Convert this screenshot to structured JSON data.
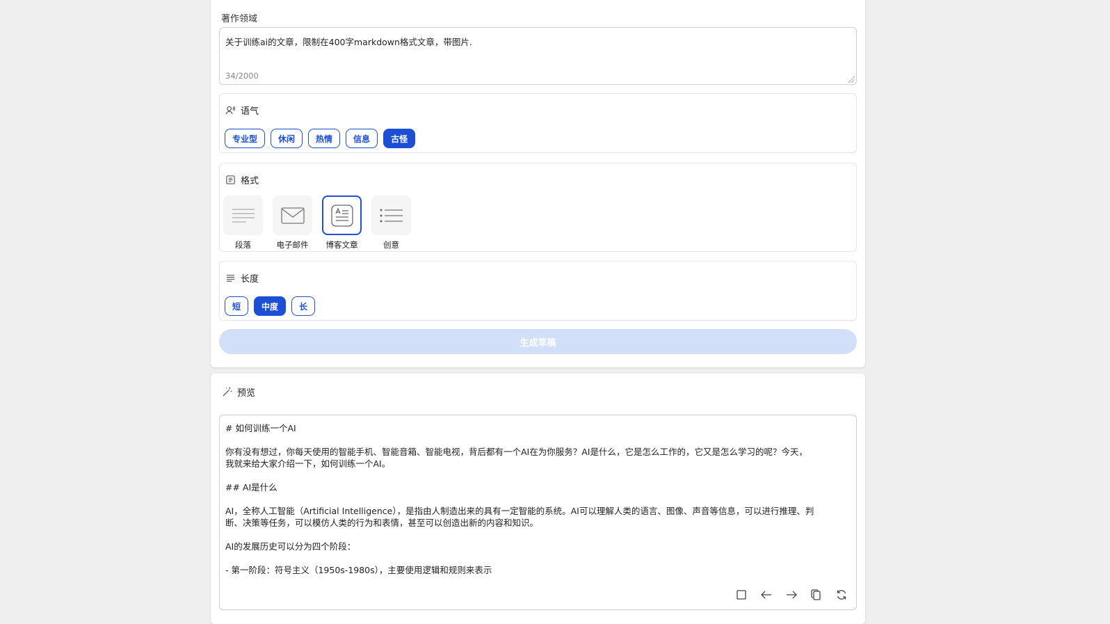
{
  "editor": {
    "label": "著作领域",
    "value": "关于训练ai的文章，限制在400字markdown格式文章，带图片.",
    "char_count": "34/2000"
  },
  "tone": {
    "title": "语气",
    "options": [
      "专业型",
      "休闲",
      "热情",
      "信息",
      "古怪"
    ],
    "selected": "古怪"
  },
  "format": {
    "title": "格式",
    "options": [
      "段落",
      "电子邮件",
      "博客文章",
      "创意"
    ],
    "selected": "博客文章"
  },
  "length": {
    "title": "长度",
    "options": [
      "短",
      "中度",
      "长"
    ],
    "selected": "中度"
  },
  "generate_label": "生成草稿",
  "preview": {
    "title": "预览",
    "content": "# 如何训练一个AI\n\n你有没有想过，你每天使用的智能手机、智能音箱、智能电视，背后都有一个AI在为你服务？AI是什么，它是怎么工作的，它又是怎么学习的呢？今天，\n我就来给大家介绍一下，如何训练一个AI。\n\n## AI是什么\n\nAI，全称人工智能（Artificial Intelligence），是指由人制造出来的具有一定智能的系统。AI可以理解人类的语言、图像、声音等信息，可以进行推理、判\n断、决策等任务，可以模仿人类的行为和表情，甚至可以创造出新的内容和知识。\n\nAI的发展历史可以分为四个阶段：\n\n- 第一阶段：符号主义（1950s-1980s），主要使用逻辑和规则来表示"
  },
  "toolbar": [
    "stop-icon",
    "undo-icon",
    "redo-icon",
    "copy-icon",
    "regenerate-icon"
  ]
}
